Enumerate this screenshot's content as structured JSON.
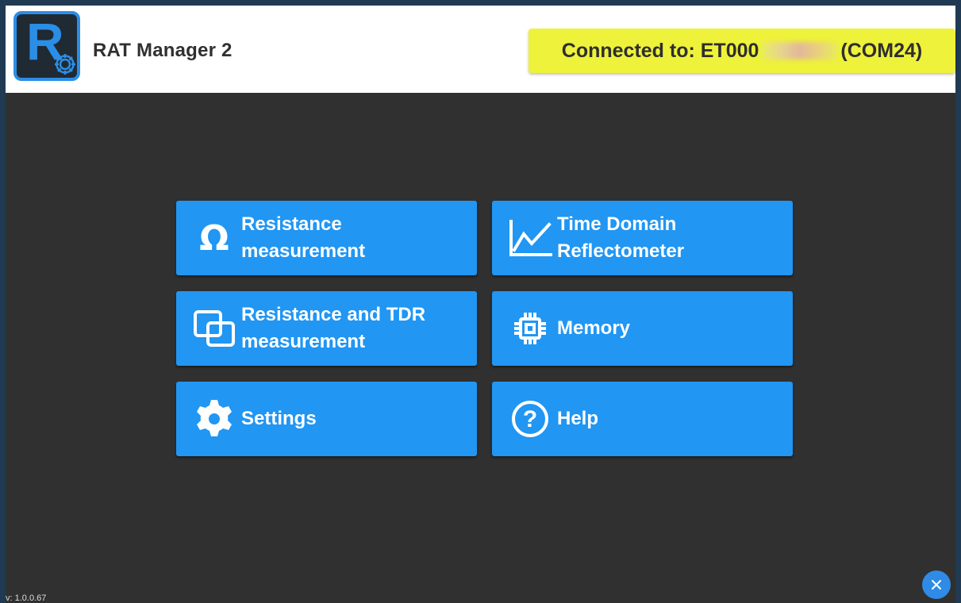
{
  "header": {
    "app_title": "RAT Manager 2",
    "logo_letter": "R",
    "connection_prefix": "Connected to: ET000",
    "connection_suffix": "(COM24)",
    "connection_bg": "#eef23a"
  },
  "tiles": [
    {
      "label": "Resistance\nmeasurement",
      "icon": "omega-icon"
    },
    {
      "label": "Time Domain\nReflectometer",
      "icon": "line-chart-icon"
    },
    {
      "label": "Resistance and TDR\nmeasurement",
      "icon": "overlapping-squares-icon"
    },
    {
      "label": "Memory",
      "icon": "chip-icon"
    },
    {
      "label": "Settings",
      "icon": "gear-icon"
    },
    {
      "label": "Help",
      "icon": "question-circle-icon"
    }
  ],
  "footer": {
    "version": "v: 1.0.0.67"
  },
  "colors": {
    "accent": "#2196f3",
    "background": "#303030",
    "header_bg": "#ffffff"
  }
}
